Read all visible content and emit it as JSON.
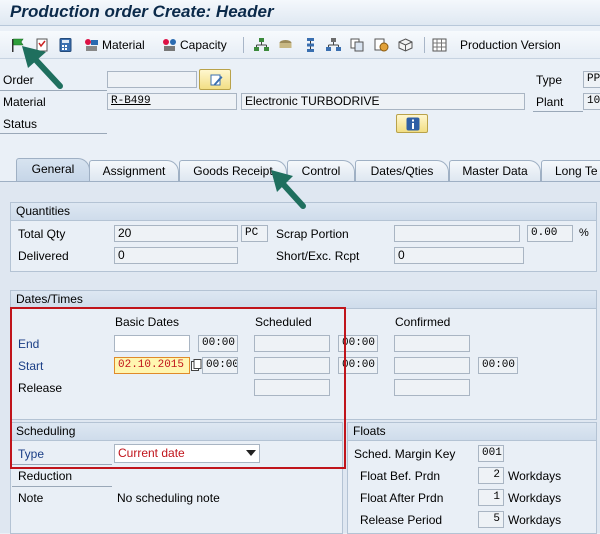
{
  "window": {
    "title": "Production order Create: Header"
  },
  "toolbar": {
    "material_label": "Material",
    "capacity_label": "Capacity",
    "production_version_label": "Production Version"
  },
  "header": {
    "order_label": "Order",
    "order_value": "",
    "material_label": "Material",
    "material_value": "R-B499",
    "material_desc": "Electronic TURBODRIVE",
    "status_label": "Status",
    "type_label": "Type",
    "type_value": "PP",
    "plant_label": "Plant",
    "plant_value": "10"
  },
  "tabs": [
    {
      "label": "General"
    },
    {
      "label": "Assignment"
    },
    {
      "label": "Goods Receipt"
    },
    {
      "label": "Control"
    },
    {
      "label": "Dates/Qties"
    },
    {
      "label": "Master Data"
    },
    {
      "label": "Long Te"
    }
  ],
  "quantities": {
    "title": "Quantities",
    "total_qty_label": "Total Qty",
    "total_qty_value": "20",
    "unit": "PC",
    "delivered_label": "Delivered",
    "delivered_value": "0",
    "scrap_label": "Scrap Portion",
    "scrap_value": "",
    "scrap_pct": "0.00",
    "pct_sign": "%",
    "short_label": "Short/Exc. Rcpt",
    "short_value": "0"
  },
  "dates": {
    "title": "Dates/Times",
    "basic_header": "Basic Dates",
    "scheduled_header": "Scheduled",
    "confirmed_header": "Confirmed",
    "end_label": "End",
    "start_label": "Start",
    "release_label": "Release",
    "end_time": "00:00",
    "end_sched_time": "00:00",
    "start_date": "02.10.2015",
    "start_time": "00:00",
    "start_sched_time": "00:00",
    "start_conf_time": "00:00"
  },
  "scheduling": {
    "title": "Scheduling",
    "type_label": "Type",
    "type_value": "Current date",
    "reduction_label": "Reduction",
    "note_label": "Note",
    "note_value": "No scheduling note"
  },
  "floats": {
    "title": "Floats",
    "margin_key_label": "Sched. Margin Key",
    "margin_key_value": "001",
    "bef_label": "Float Bef. Prdn",
    "bef_value": "2",
    "after_label": "Float After Prdn",
    "after_value": "1",
    "release_label": "Release Period",
    "release_value": "5",
    "unit": "Workdays"
  },
  "colors": {
    "highlight_box": "#c0141b",
    "callout_arrow": "#1f6f5e",
    "title_text": "#0b2a4a"
  }
}
